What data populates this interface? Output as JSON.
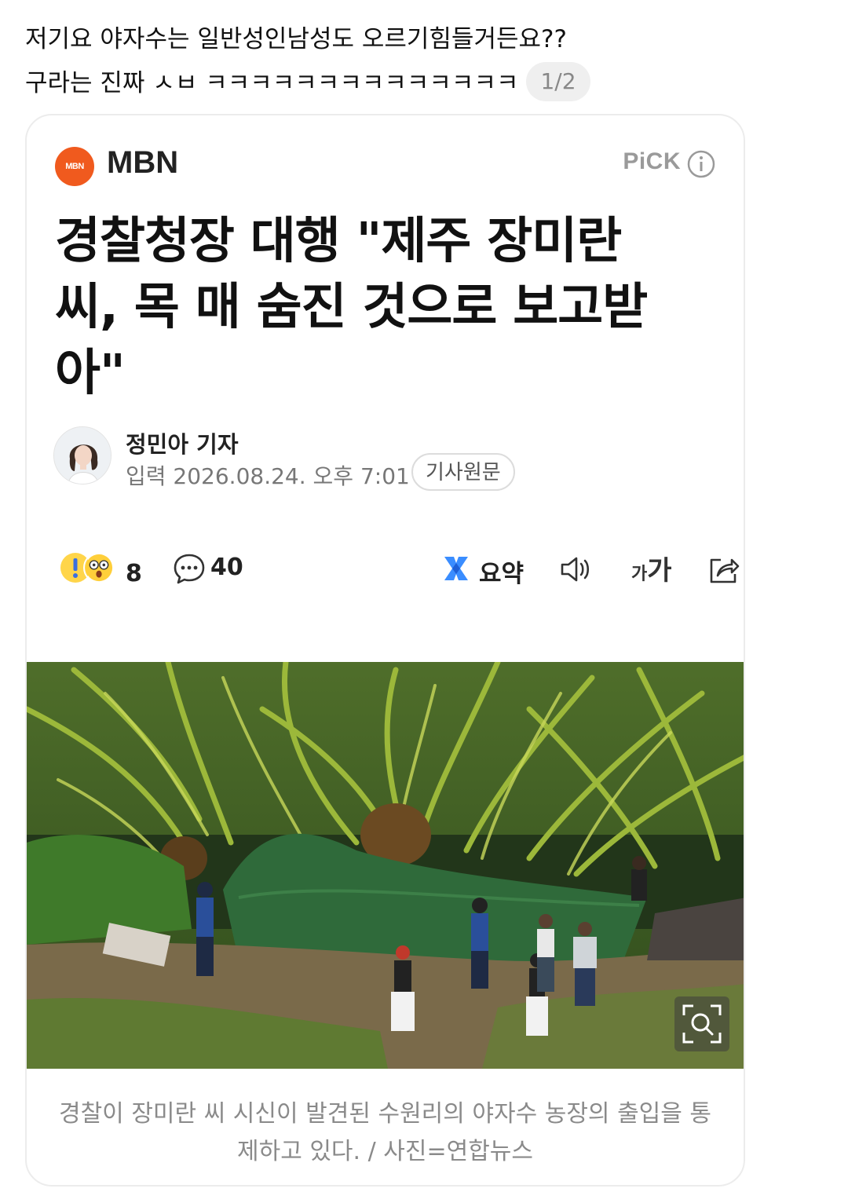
{
  "post": {
    "line1": "저기요 야자수는 일반성인남성도 오르기힘들거든요??",
    "line2": "구라는 진짜 ㅅㅂ ㅋㅋㅋㅋㅋㅋㅋㅋㅋㅋㅋㅋㅋㅋ",
    "page_indicator": "1/2"
  },
  "article": {
    "press_name": "MBN",
    "press_logo_text": "MBN",
    "pick_label": "PiCK",
    "headline": "경찰청장 대행 \"제주 장미란 씨, 목 매 숨진 것으로 보고받아\"",
    "reporter": "정민아 기자",
    "date": "입력 2026.08.24. 오후 7:01",
    "original_button": "기사원문",
    "reaction_count": "8",
    "comment_count": "40",
    "summary_label": "요약",
    "font_size_small": "가",
    "font_size_large": "가",
    "caption": "경찰이 장미란 씨 시신이 발견된 수원리의 야자수 농장의 출입을 통제하고 있다. / 사진=연합뉴스"
  },
  "colors": {
    "press_logo": "#f05a1e",
    "summary_icon": "#3a8dff",
    "pick": "#9a9a9a",
    "caption": "#8a8a8a"
  },
  "icons": [
    "info-icon",
    "surprised-emoji-icon",
    "comment-icon",
    "summary-icon",
    "speaker-icon",
    "font-size-icon",
    "share-icon",
    "zoom-icon"
  ]
}
